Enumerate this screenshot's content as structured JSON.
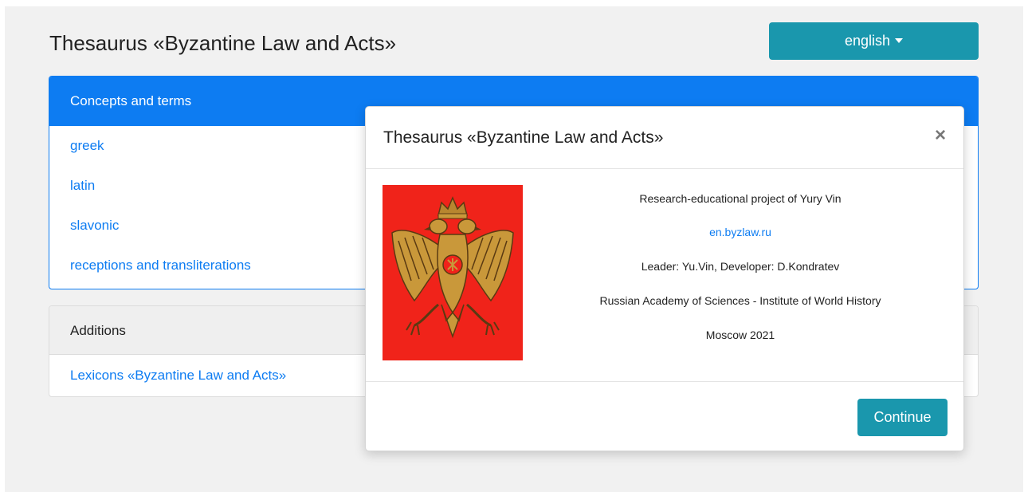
{
  "header": {
    "title": "Thesaurus «Byzantine Law and Acts»",
    "language_label": "english"
  },
  "concepts_card": {
    "title": "Concepts and terms",
    "links": [
      "greek",
      "latin",
      "slavonic",
      "receptions and transliterations"
    ]
  },
  "additions_card": {
    "title": "Additions",
    "links": [
      "Lexicons «Byzantine Law and Acts»"
    ]
  },
  "modal": {
    "title": "Thesaurus «Byzantine Law and Acts»",
    "close_symbol": "×",
    "project": "Research-educational project of Yury Vin",
    "site_link": "en.byzlaw.ru",
    "credits": "Leader: Yu.Vin, Developer: D.Kondratev",
    "institution": "Russian Academy of Sciences - Institute of World History",
    "place_year": "Moscow 2021",
    "continue_label": "Continue"
  },
  "colors": {
    "primary": "#0d7cf2",
    "teal_button": "#1a97ad",
    "emblem_background": "#f0231a",
    "emblem_gold": "#c9983a"
  }
}
